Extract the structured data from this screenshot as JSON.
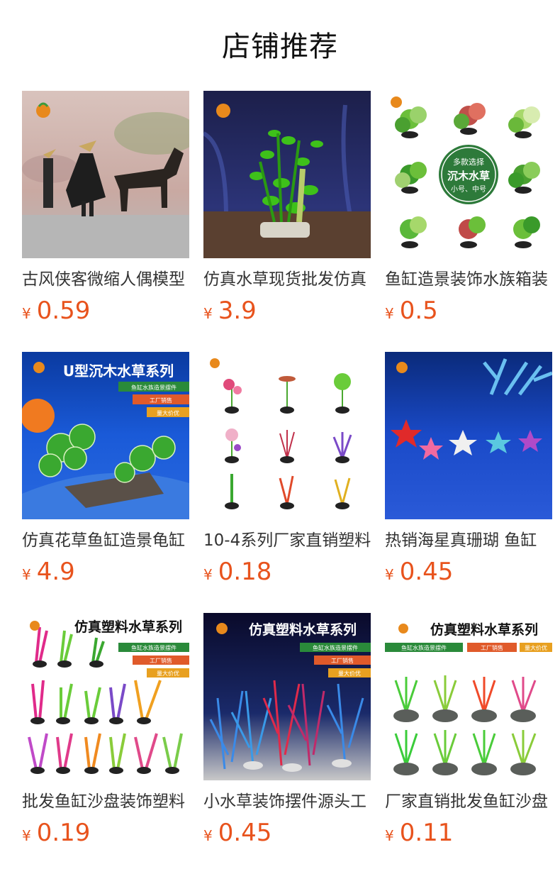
{
  "section": {
    "title": "店铺推荐"
  },
  "currency_symbol": "¥",
  "products": [
    {
      "name": "古风侠客微缩人偶模型",
      "price": "0.59"
    },
    {
      "name": "仿真水草现货批发仿真",
      "price": "3.9"
    },
    {
      "name": "鱼缸造景装饰水族箱装",
      "price": "0.5",
      "image_text": {
        "line1": "多款选择",
        "line2": "沉木水草",
        "line3": "小号、中号"
      }
    },
    {
      "name": "仿真花草鱼缸造景龟缸",
      "price": "4.9",
      "image_text": {
        "title": "U型沉木水草系列",
        "tag1": "鱼缸水族造景摆件",
        "tag2": "工厂销售",
        "tag3": "量大价优"
      }
    },
    {
      "name": "10-4系列厂家直销塑料",
      "price": "0.18"
    },
    {
      "name": "热销海星真珊瑚 鱼缸",
      "price": "0.45"
    },
    {
      "name": "批发鱼缸沙盘装饰塑料",
      "price": "0.19",
      "image_text": {
        "title": "仿真塑料水草系列",
        "tag1": "鱼缸水族造景摆件",
        "tag2": "工厂销售",
        "tag3": "量大价优"
      }
    },
    {
      "name": "小水草装饰摆件源头工",
      "price": "0.45",
      "image_text": {
        "title": "仿真塑料水草系列",
        "tag1": "鱼缸水族造景摆件",
        "tag2": "工厂销售",
        "tag3": "量大价优"
      }
    },
    {
      "name": "厂家直销批发鱼缸沙盘",
      "price": "0.11",
      "image_text": {
        "title": "仿真塑料水草系列",
        "tag1": "鱼缸水族造景摆件",
        "tag2": "工厂销售",
        "tag3": "量大价优"
      }
    }
  ]
}
